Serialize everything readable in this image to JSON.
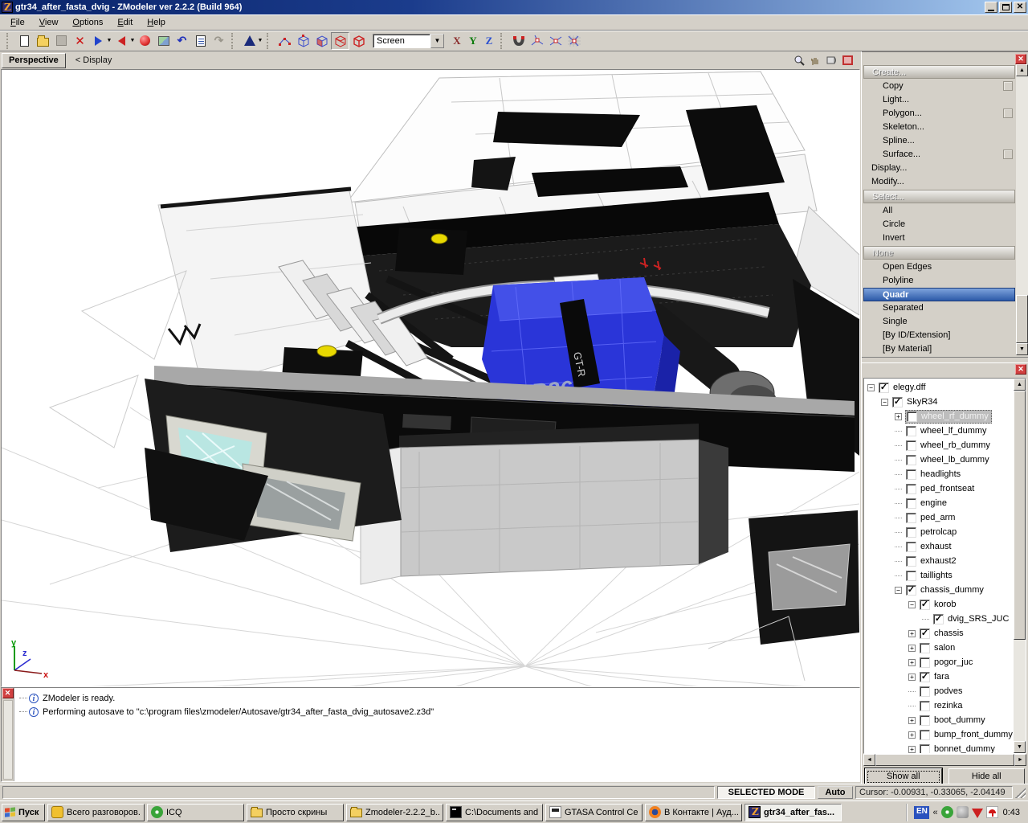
{
  "window": {
    "title": "gtr34_after_fasta_dvig - ZModeler ver 2.2.2 (Build 964)",
    "app_icon": "zmodeler-z-icon"
  },
  "menu": {
    "items": [
      "File",
      "View",
      "Options",
      "Edit",
      "Help"
    ]
  },
  "toolbar": {
    "icons": [
      "new-file-icon",
      "open-file-icon",
      "save-icon",
      "delete-icon",
      "import-icon",
      "export-icon",
      "material-editor-icon",
      "texture-browser-icon",
      "undo-icon",
      "history-icon",
      "redo-icon",
      "create-primitive-icon",
      "vertices-mode-icon",
      "edges-mode-icon",
      "faces-mode-icon",
      "polygons-mode-icon",
      "objects-mode-icon",
      "snap-magnet-icon",
      "snap-vertex-icon",
      "snap-edge-icon",
      "snap-grid-icon"
    ],
    "screen_dropdown": "Screen",
    "axis": {
      "x": "X",
      "y": "Y",
      "z": "Z"
    }
  },
  "viewport": {
    "tab": "Perspective",
    "breadcrumb": "<  Display",
    "axis_labels": {
      "x": "x",
      "y": "y",
      "z": "z"
    },
    "engine_label": "RB26",
    "engine_badge": "GT-R"
  },
  "command_panel": {
    "items": [
      {
        "label": "Create...",
        "type": "header"
      },
      {
        "label": "Copy",
        "indent": 1,
        "box": true
      },
      {
        "label": "Light...",
        "indent": 1
      },
      {
        "label": "Polygon...",
        "indent": 1,
        "box": true
      },
      {
        "label": "Skeleton...",
        "indent": 1
      },
      {
        "label": "Spline...",
        "indent": 1
      },
      {
        "label": "Surface...",
        "indent": 1,
        "box": true
      },
      {
        "label": "Display...",
        "indent": 0
      },
      {
        "label": "Modify...",
        "indent": 0
      },
      {
        "label": "Select...",
        "type": "header"
      },
      {
        "label": "All",
        "indent": 1
      },
      {
        "label": "Circle",
        "indent": 1
      },
      {
        "label": "Invert",
        "indent": 1
      },
      {
        "label": "None",
        "type": "header",
        "state": "dim"
      },
      {
        "label": "Open Edges",
        "indent": 1
      },
      {
        "label": "Polyline",
        "indent": 1
      },
      {
        "label": "Quadr",
        "indent": 1,
        "state": "selected"
      },
      {
        "label": "Separated",
        "indent": 1
      },
      {
        "label": "Single",
        "indent": 1
      },
      {
        "label": "[By ID/Extension]",
        "indent": 1
      },
      {
        "label": "[By Material]",
        "indent": 1
      }
    ]
  },
  "scene_tree": {
    "nodes": [
      {
        "label": "elegy.dff",
        "depth": 0,
        "checked": true,
        "expander": "minus"
      },
      {
        "label": "SkyR34",
        "depth": 1,
        "checked": true,
        "expander": "minus"
      },
      {
        "label": "wheel_rf_dummy",
        "depth": 2,
        "checked": false,
        "expander": "plus",
        "selected": true
      },
      {
        "label": "wheel_lf_dummy",
        "depth": 2,
        "checked": false
      },
      {
        "label": "wheel_rb_dummy",
        "depth": 2,
        "checked": false
      },
      {
        "label": "wheel_lb_dummy",
        "depth": 2,
        "checked": false
      },
      {
        "label": "headlights",
        "depth": 2,
        "checked": false
      },
      {
        "label": "ped_frontseat",
        "depth": 2,
        "checked": false
      },
      {
        "label": "engine",
        "depth": 2,
        "checked": false
      },
      {
        "label": "ped_arm",
        "depth": 2,
        "checked": false
      },
      {
        "label": "petrolcap",
        "depth": 2,
        "checked": false
      },
      {
        "label": "exhaust",
        "depth": 2,
        "checked": false
      },
      {
        "label": "exhaust2",
        "depth": 2,
        "checked": false
      },
      {
        "label": "taillights",
        "depth": 2,
        "checked": false
      },
      {
        "label": "chassis_dummy",
        "depth": 2,
        "checked": true,
        "expander": "minus"
      },
      {
        "label": "korob",
        "depth": 3,
        "checked": true,
        "expander": "minus"
      },
      {
        "label": "dvig_SRS_JUC",
        "depth": 4,
        "checked": true
      },
      {
        "label": "chassis",
        "depth": 3,
        "checked": true,
        "expander": "plus"
      },
      {
        "label": "salon",
        "depth": 3,
        "checked": false,
        "expander": "plus"
      },
      {
        "label": "pogor_juc",
        "depth": 3,
        "checked": false,
        "expander": "plus"
      },
      {
        "label": "fara",
        "depth": 3,
        "checked": true,
        "expander": "plus"
      },
      {
        "label": "podves",
        "depth": 3,
        "checked": false
      },
      {
        "label": "rezinka",
        "depth": 3,
        "checked": false
      },
      {
        "label": "boot_dummy",
        "depth": 3,
        "checked": false,
        "expander": "plus"
      },
      {
        "label": "bump_front_dummy",
        "depth": 3,
        "checked": false,
        "expander": "plus"
      },
      {
        "label": "bonnet_dummy",
        "depth": 3,
        "checked": false,
        "expander": "plus"
      }
    ],
    "buttons": {
      "show_all": "Show all",
      "hide_all": "Hide all"
    }
  },
  "log": {
    "lines": [
      "ZModeler is ready.",
      "Performing autosave to \"c:\\program files\\zmodeler/Autosave/gtr34_after_fasta_dvig_autosave2.z3d\""
    ]
  },
  "status_bar": {
    "mode": "SELECTED MODE",
    "auto": "Auto",
    "cursor": "Cursor: -0.00931, -0.33065, -2.04149"
  },
  "taskbar": {
    "start": "Пуск",
    "tasks": [
      {
        "label": "Всего разговоров...",
        "icon": "chat-icon"
      },
      {
        "label": "ICQ",
        "icon": "icq-flower-icon"
      },
      {
        "label": "Просто скрины",
        "icon": "folder-icon"
      },
      {
        "label": "Zmodeler-2.2.2_b...",
        "icon": "folder-icon"
      },
      {
        "label": "C:\\Documents and...",
        "icon": "cmd-icon"
      },
      {
        "label": "GTASA Control Ce...",
        "icon": "gta-icon"
      },
      {
        "label": "В Контакте | Ауд...",
        "icon": "firefox-icon"
      },
      {
        "label": "gtr34_after_fas...",
        "icon": "zmodeler-icon",
        "active": true
      }
    ],
    "tray": {
      "lang": "EN",
      "clock": "0:43",
      "icons": [
        "icq-flower-icon",
        "gray-app-icon",
        "download-arrow-icon",
        "avira-umbrella-icon"
      ]
    }
  },
  "colors": {
    "titlebar_start": "#0a246a",
    "titlebar_end": "#a6caf0",
    "chrome": "#d4d0c8",
    "selection_blue": "#2c5aa8",
    "engine_blue": "#2a35d8",
    "cap_yellow": "#e8d800"
  }
}
